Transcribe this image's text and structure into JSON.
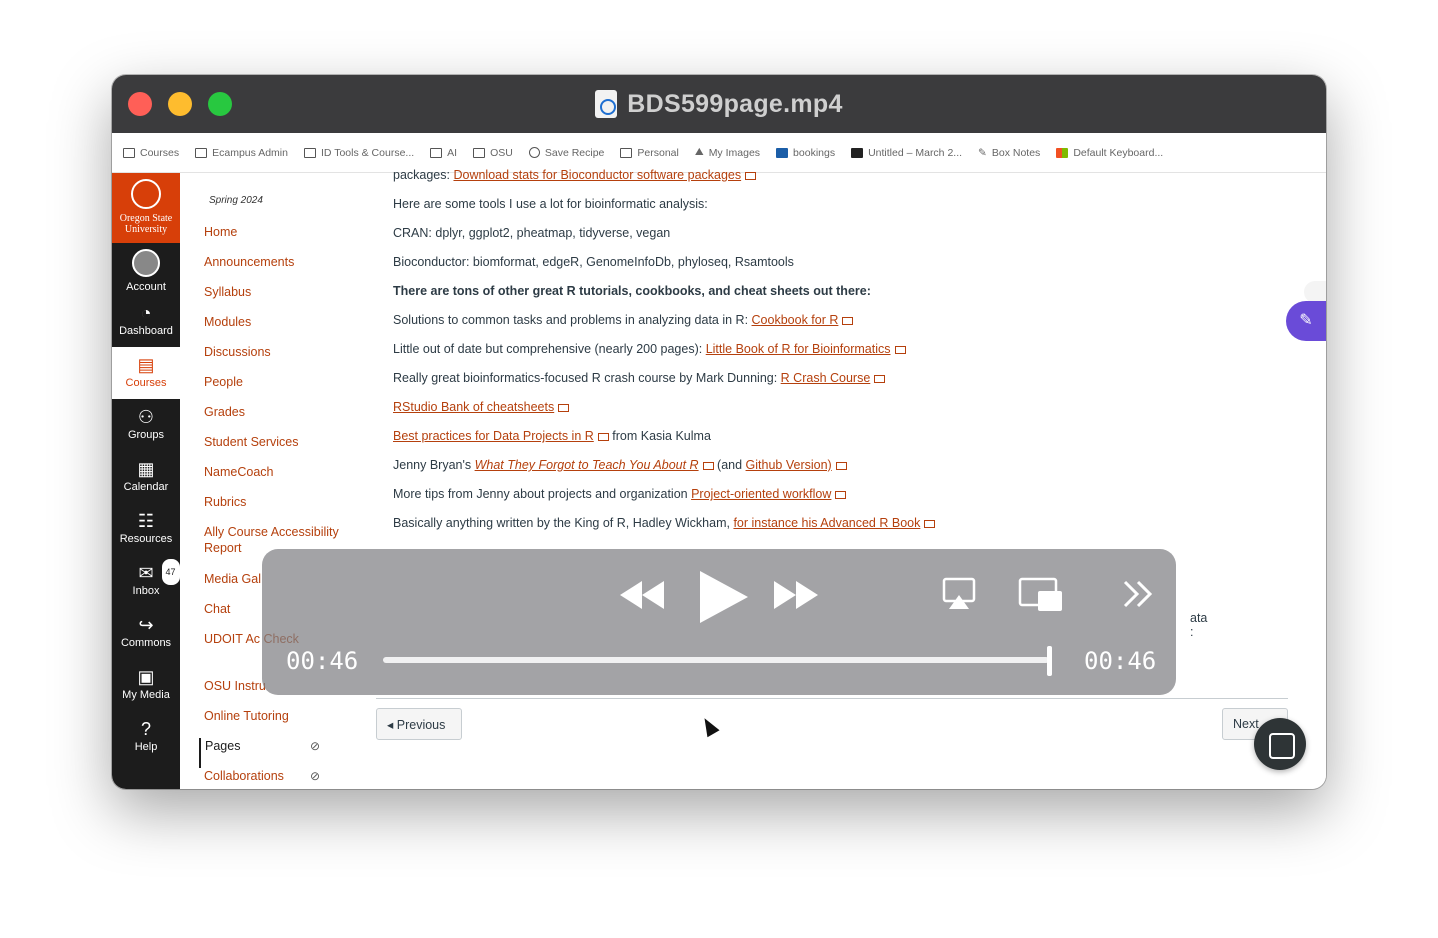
{
  "window": {
    "title": "BDS599page.mp4"
  },
  "bookmarks": [
    {
      "label": "Courses",
      "icon": "folder-icon"
    },
    {
      "label": "Ecampus Admin",
      "icon": "folder-icon"
    },
    {
      "label": "ID Tools & Course...",
      "icon": "folder-icon"
    },
    {
      "label": "AI",
      "icon": "folder-icon"
    },
    {
      "label": "OSU",
      "icon": "folder-icon"
    },
    {
      "label": "Save Recipe",
      "icon": "globe-icon"
    },
    {
      "label": "Personal",
      "icon": "folder-icon"
    },
    {
      "label": "My Images",
      "icon": "image-icon"
    },
    {
      "label": "bookings",
      "icon": "bookings-icon"
    },
    {
      "label": "Untitled – March 2...",
      "icon": "app-icon"
    },
    {
      "label": "Box Notes",
      "icon": "notes-icon"
    },
    {
      "label": "Default Keyboard...",
      "icon": "microsoft-icon"
    }
  ],
  "global_nav": {
    "logo_text": "Oregon State University",
    "items": [
      {
        "label": "Account",
        "icon": "avatar-icon"
      },
      {
        "label": "Dashboard",
        "icon": "dashboard-icon"
      },
      {
        "label": "Courses",
        "icon": "courses-icon",
        "active": true
      },
      {
        "label": "Groups",
        "icon": "groups-icon"
      },
      {
        "label": "Calendar",
        "icon": "calendar-icon"
      },
      {
        "label": "Resources",
        "icon": "resources-icon"
      },
      {
        "label": "Inbox",
        "icon": "inbox-icon",
        "badge": "47"
      },
      {
        "label": "Commons",
        "icon": "commons-icon"
      },
      {
        "label": "My Media",
        "icon": "media-icon"
      },
      {
        "label": "Help",
        "icon": "help-icon"
      }
    ]
  },
  "course_nav": {
    "term": "Spring 2024",
    "items": [
      "Home",
      "Announcements",
      "Syllabus",
      "Modules",
      "Discussions",
      "People",
      "Grades",
      "Student Services",
      "NameCoach",
      "Rubrics",
      "Ally Course Accessibility Report",
      "Media Gal",
      "Chat",
      "UDOIT Ac Check",
      "OSU Instru",
      "Online Tutoring",
      "Pages",
      "Collaborations"
    ]
  },
  "content": {
    "l0_prefix": "packages: ",
    "l0_link": "Download stats for Bioconductor software packages",
    "l1": "Here are some tools I use a lot for bioinformatic analysis:",
    "l2": "CRAN: dplyr, ggplot2, pheatmap, tidyverse, vegan",
    "l3": "Bioconductor: biomformat, edgeR, GenomeInfoDb, phyloseq, Rsamtools",
    "l4": "There are tons of other great R tutorials, cookbooks, and cheat sheets out there:",
    "l5_prefix": "Solutions to common tasks and problems in analyzing data in R: ",
    "l5_link": "Cookbook for R",
    "l6_prefix": "Little out of date but comprehensive (nearly 200 pages): ",
    "l6_link": "Little Book of R for Bioinformatics",
    "l7_prefix": "Really great bioinformatics-focused R crash course by Mark Dunning: ",
    "l7_link": "R Crash Course",
    "l8_link": "RStudio Bank of cheatsheets",
    "l9_link": "Best practices for Data Projects in R",
    "l9_suffix": " from Kasia Kulma",
    "l10_prefix": "Jenny Bryan's ",
    "l10_link": "What They Forgot to Teach You About R",
    "l10_mid": " (and ",
    "l10_link2": "Github Version)",
    "l11_prefix": "More tips from Jenny about projects and organization ",
    "l11_link": "Project-oriented workflow",
    "l12_prefix": "Basically anything written by the King of R, Hadley Wickham, ",
    "l12_link": "for instance his Advanced R Book",
    "partial_right_1": "ata",
    "partial_right_2": ":",
    "prev_label": "Previous",
    "next_label": "Next"
  },
  "player": {
    "current_time": "00:46",
    "total_time": "00:46",
    "progress": 1.0
  },
  "colors": {
    "accent": "#d73f09",
    "link": "#b5400d",
    "nav_bg": "#1c1c1c",
    "titlebar": "#3b3b3d"
  }
}
